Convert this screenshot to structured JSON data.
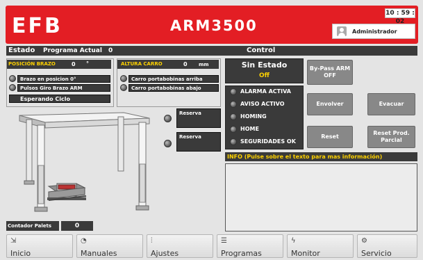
{
  "header": {
    "logo": "EFB",
    "model": "ARM3500",
    "clock": "10 : 59 : 02",
    "user": "Administrador"
  },
  "status_bar": {
    "estado_label": "Estado",
    "programa_label": "Programa Actual",
    "programa_value": "0",
    "control_label": "Control"
  },
  "posicion_brazo": {
    "title": "POSICIÓN BRAZO",
    "value": "0",
    "unit": "°",
    "items": [
      "Brazo en posicion 0°",
      "Pulsos Giro Brazo ARM"
    ],
    "state": "Esperando Ciclo"
  },
  "altura_carro": {
    "title": "ALTURA CARRO",
    "value": "0",
    "unit": "mm",
    "items": [
      "Carro portabobinas arriba",
      "Carro portabobinas abajo"
    ]
  },
  "reservas": [
    "Reserva",
    "Reserva"
  ],
  "control": {
    "state_title": "Sin Estado",
    "state_value": "Off",
    "alarms": [
      "ALARMA ACTIVA",
      "AVISO ACTIVO",
      "HOMING",
      "HOME",
      "SEGURIDADES OK"
    ],
    "buttons": {
      "bypass": "By-Pass ARM\nOFF",
      "envolver": "Envolver",
      "evacuar": "Evacuar",
      "reset": "Reset",
      "reset_prod": "Reset Prod.\nParcial"
    }
  },
  "info": {
    "title": "INFO (Pulse sobre el texto para mas información)"
  },
  "contador": {
    "label": "Contador Palets",
    "value": "0"
  },
  "nav": [
    {
      "icon": "login-icon",
      "label": "Inicio"
    },
    {
      "icon": "gauge-icon",
      "label": "Manuales"
    },
    {
      "icon": "sliders-icon",
      "label": "Ajustes"
    },
    {
      "icon": "program-icon",
      "label": "Programas"
    },
    {
      "icon": "bolt-icon",
      "label": "Monitor"
    },
    {
      "icon": "gear-icon",
      "label": "Servicio"
    }
  ],
  "colors": {
    "header": "#e31e24",
    "panel_dark": "#3a3a3a",
    "label_yellow": "#ffd200",
    "state_value": "#ffd200",
    "button_gray": "#888888"
  }
}
